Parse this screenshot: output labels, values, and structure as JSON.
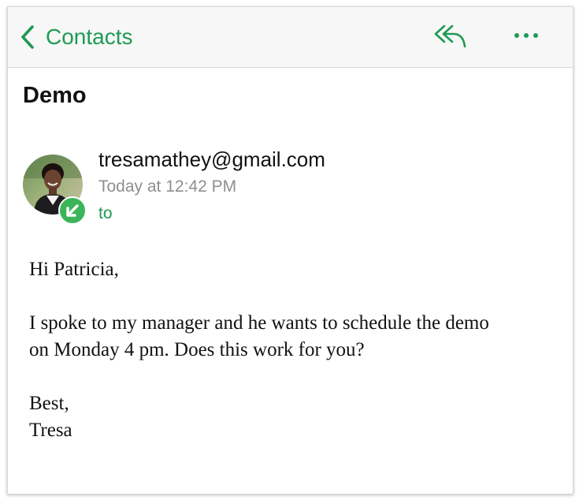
{
  "navbar": {
    "back_label": "Contacts",
    "back_icon": "chevron-left-icon",
    "reply_icon": "reply-icon",
    "more_icon": "more-horizontal-icon",
    "accent_color": "#1e9b52",
    "background_color": "#f7f7f7"
  },
  "email": {
    "subject": "Demo",
    "sender": "tresamathey@gmail.com",
    "timestamp": "Today at 12:42 PM",
    "recipient_label": "to",
    "direction_badge": "incoming-arrow-icon",
    "badge_color": "#3cb55a",
    "body": {
      "greeting": "Hi Patricia,",
      "line1": "I spoke to my manager and he wants to schedule the demo",
      "line2": "on Monday 4 pm. Does this work for you?",
      "closing": "Best,",
      "signature": "Tresa"
    }
  }
}
